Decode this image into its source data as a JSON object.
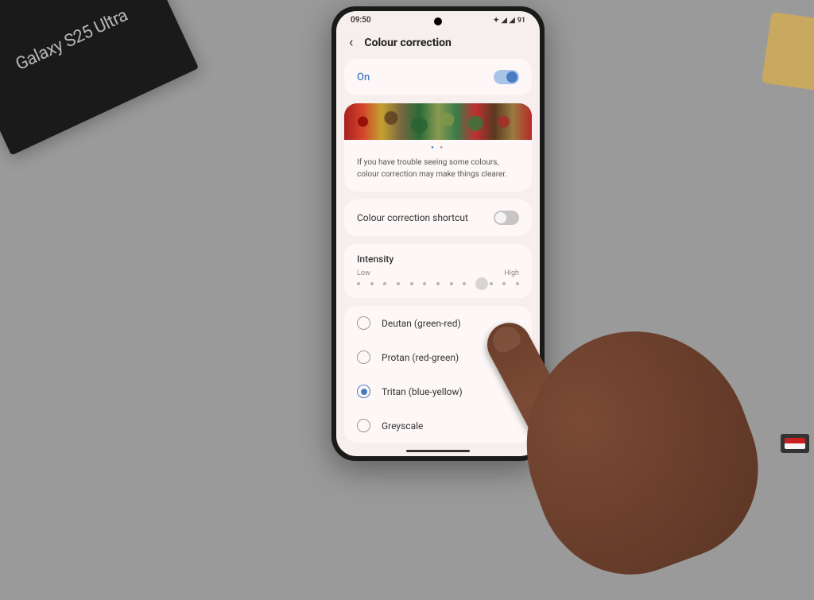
{
  "background": {
    "product_box_text": "Galaxy S25 Ultra"
  },
  "status": {
    "time": "09:50",
    "battery": "91"
  },
  "header": {
    "title": "Colour correction"
  },
  "master_toggle": {
    "label": "On",
    "enabled": true
  },
  "banner": {
    "description": "If you have trouble seeing some colours, colour correction may make things clearer."
  },
  "shortcut": {
    "label": "Colour correction shortcut",
    "enabled": false
  },
  "intensity": {
    "title": "Intensity",
    "low_label": "Low",
    "high_label": "High",
    "value": 10,
    "max": 13
  },
  "options": [
    {
      "label": "Deutan (green-red)",
      "selected": false
    },
    {
      "label": "Protan (red-green)",
      "selected": false
    },
    {
      "label": "Tritan (blue-yellow)",
      "selected": true
    },
    {
      "label": "Greyscale",
      "selected": false
    }
  ]
}
